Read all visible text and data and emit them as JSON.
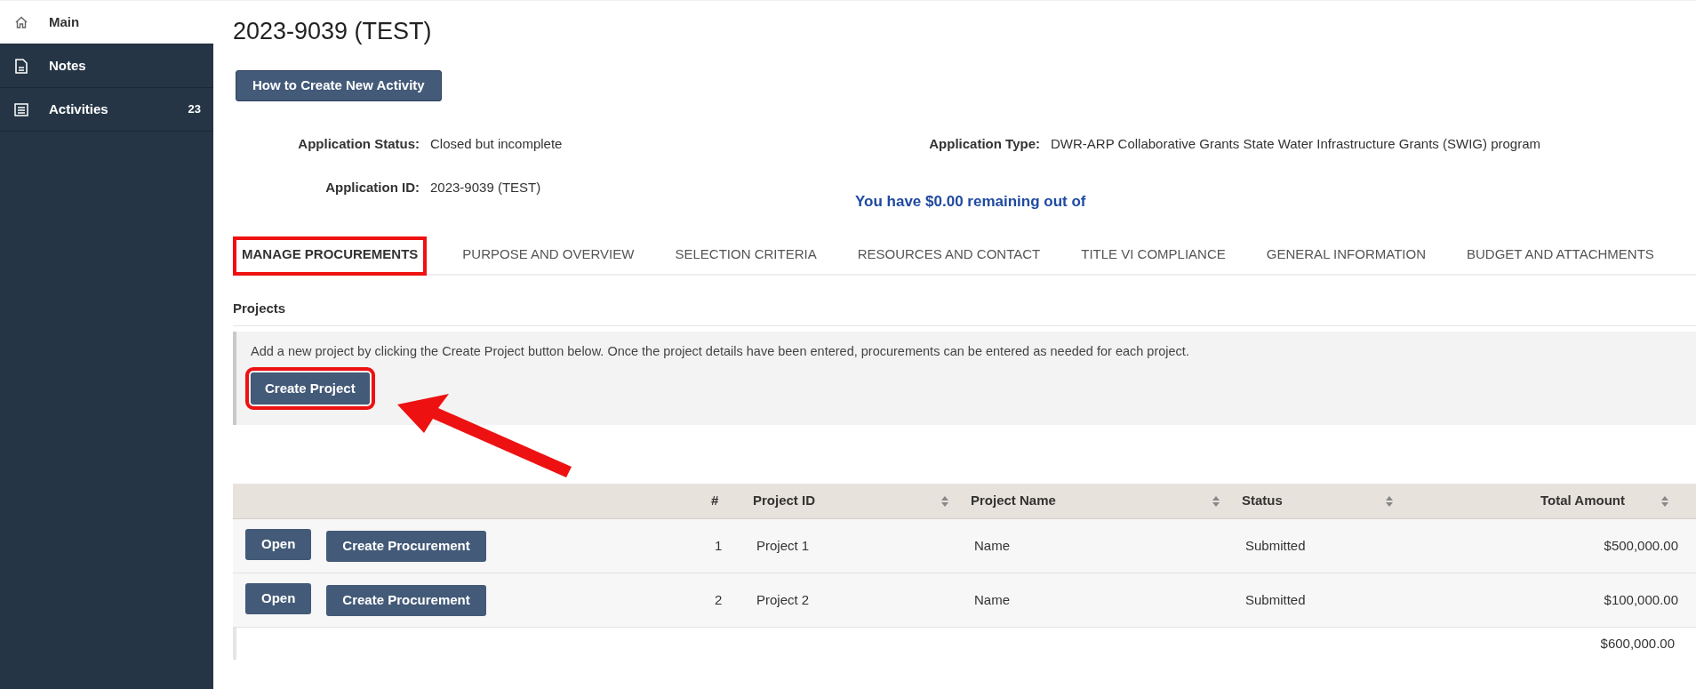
{
  "sidebar": {
    "items": [
      {
        "label": "Main",
        "kind": "home",
        "selected": true
      },
      {
        "label": "Notes",
        "kind": "document",
        "selected": false
      },
      {
        "label": "Activities",
        "kind": "list",
        "badge": "23",
        "selected": false
      }
    ]
  },
  "page": {
    "title": "2023-9039 (TEST)",
    "help_button": "How to Create New Activity"
  },
  "details": [
    {
      "label": "Application Status:",
      "value": "Closed but incomplete"
    },
    {
      "label": "Application Type:",
      "value": "DWR-ARP Collaborative Grants State Water Infrastructure Grants (SWIG) program"
    },
    {
      "label": "Application ID:",
      "value": "2023-9039 (TEST)"
    }
  ],
  "remaining_notice": "You have $0.00 remaining out of",
  "tabs": [
    {
      "label": "MANAGE PROCUREMENTS",
      "selected": true,
      "highlighted": true
    },
    {
      "label": "PURPOSE AND OVERVIEW",
      "selected": false,
      "highlighted": false
    },
    {
      "label": "SELECTION CRITERIA",
      "selected": false,
      "highlighted": false
    },
    {
      "label": "RESOURCES AND CONTACT",
      "selected": false,
      "highlighted": false
    },
    {
      "label": "TITLE VI COMPLIANCE",
      "selected": false,
      "highlighted": false
    },
    {
      "label": "GENERAL INFORMATION",
      "selected": false,
      "highlighted": false
    },
    {
      "label": "BUDGET AND ATTACHMENTS",
      "selected": false,
      "highlighted": false
    }
  ],
  "projects": {
    "heading": "Projects",
    "instructions": "Add a new project by clicking the Create Project button below. Once the project details have been entered, procurements can be entered as needed for each project.",
    "create_button": {
      "label": "Create Project",
      "highlighted": true
    },
    "pointer_arrow": true
  },
  "table": {
    "columns": [
      {
        "label": "#",
        "sortable": false
      },
      {
        "label": "Project ID",
        "sortable": true
      },
      {
        "label": "Project Name",
        "sortable": true
      },
      {
        "label": "Status",
        "sortable": true
      },
      {
        "label": "Total Amount",
        "sortable": true
      }
    ],
    "rows": [
      {
        "actions": [
          "Open",
          "Create Procurement"
        ],
        "cells": [
          "1",
          "Project 1",
          "Name",
          "Submitted",
          "$500,000.00"
        ]
      },
      {
        "actions": [
          "Open",
          "Create Procurement"
        ],
        "cells": [
          "2",
          "Project 2",
          "Name",
          "Submitted",
          "$100,000.00"
        ]
      }
    ],
    "total": "$600,000.00"
  }
}
